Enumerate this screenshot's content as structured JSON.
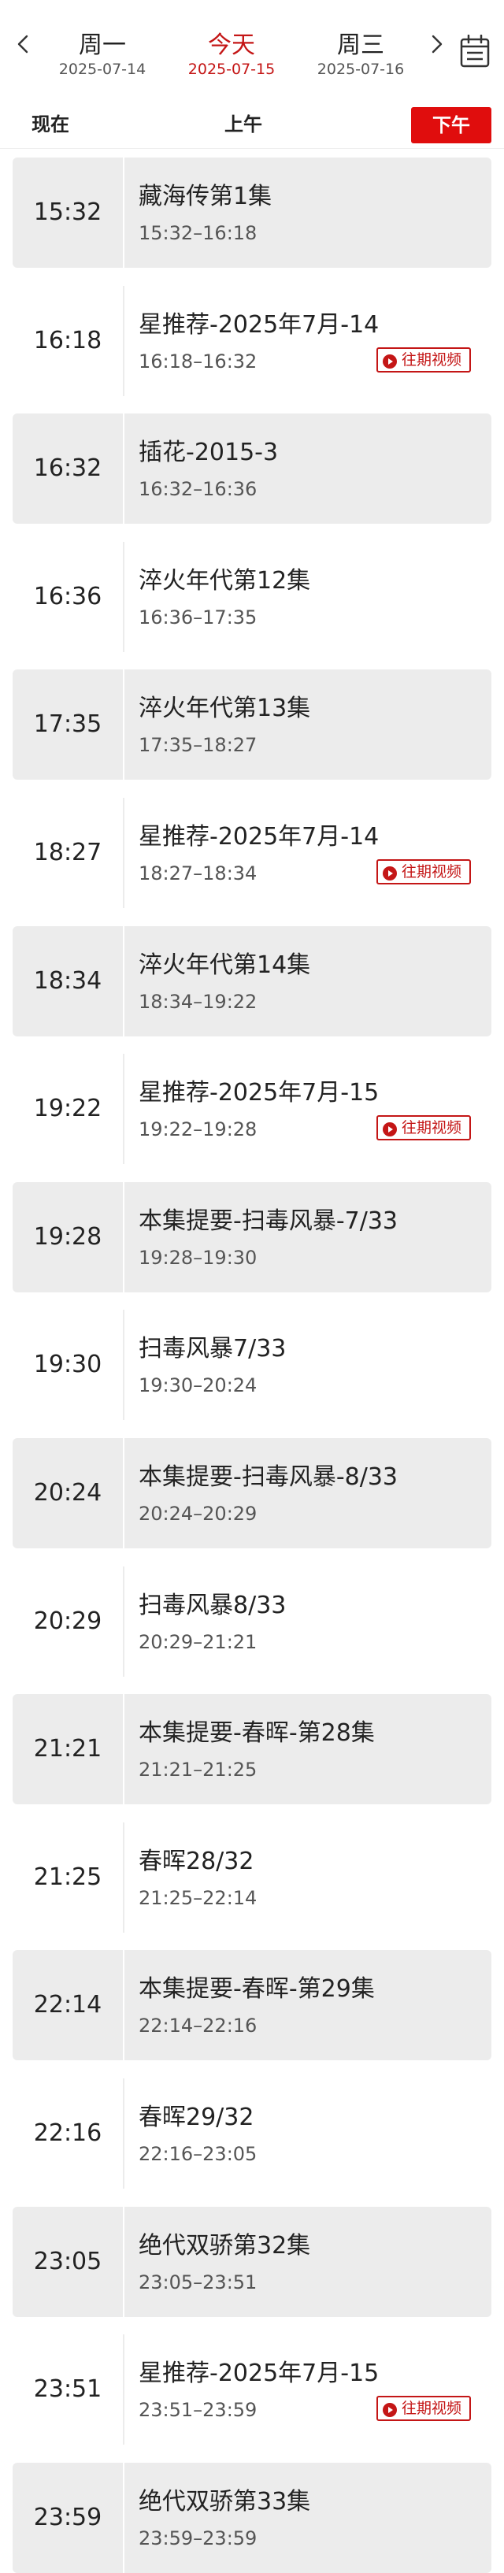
{
  "header": {
    "days": [
      {
        "weekday": "周一",
        "date": "2025-07-14"
      },
      {
        "weekday": "今天",
        "date": "2025-07-15"
      },
      {
        "weekday": "周三",
        "date": "2025-07-16"
      }
    ],
    "active_day": 1
  },
  "periods": {
    "now": "现在",
    "morning": "上午",
    "afternoon": "下午"
  },
  "colors": {
    "accent": "#e00d0d",
    "active_text": "#c41616",
    "card_grey": "#ececec"
  },
  "replay_label": "往期视频",
  "programs": [
    {
      "start": "15:32",
      "title": "藏海传第1集",
      "range": "15:32–16:18",
      "replay": false
    },
    {
      "start": "16:18",
      "title": "星推荐-2025年7月-14",
      "range": "16:18–16:32",
      "replay": true
    },
    {
      "start": "16:32",
      "title": "插花-2015-3",
      "range": "16:32–16:36",
      "replay": false
    },
    {
      "start": "16:36",
      "title": "淬火年代第12集",
      "range": "16:36–17:35",
      "replay": false
    },
    {
      "start": "17:35",
      "title": "淬火年代第13集",
      "range": "17:35–18:27",
      "replay": false
    },
    {
      "start": "18:27",
      "title": "星推荐-2025年7月-14",
      "range": "18:27–18:34",
      "replay": true
    },
    {
      "start": "18:34",
      "title": "淬火年代第14集",
      "range": "18:34–19:22",
      "replay": false
    },
    {
      "start": "19:22",
      "title": "星推荐-2025年7月-15",
      "range": "19:22–19:28",
      "replay": true
    },
    {
      "start": "19:28",
      "title": "本集提要-扫毒风暴-7/33",
      "range": "19:28–19:30",
      "replay": false
    },
    {
      "start": "19:30",
      "title": "扫毒风暴7/33",
      "range": "19:30–20:24",
      "replay": false
    },
    {
      "start": "20:24",
      "title": "本集提要-扫毒风暴-8/33",
      "range": "20:24–20:29",
      "replay": false
    },
    {
      "start": "20:29",
      "title": "扫毒风暴8/33",
      "range": "20:29–21:21",
      "replay": false
    },
    {
      "start": "21:21",
      "title": "本集提要-春晖-第28集",
      "range": "21:21–21:25",
      "replay": false
    },
    {
      "start": "21:25",
      "title": "春晖28/32",
      "range": "21:25–22:14",
      "replay": false
    },
    {
      "start": "22:14",
      "title": "本集提要-春晖-第29集",
      "range": "22:14–22:16",
      "replay": false
    },
    {
      "start": "22:16",
      "title": "春晖29/32",
      "range": "22:16–23:05",
      "replay": false
    },
    {
      "start": "23:05",
      "title": "绝代双骄第32集",
      "range": "23:05–23:51",
      "replay": false
    },
    {
      "start": "23:51",
      "title": "星推荐-2025年7月-15",
      "range": "23:51–23:59",
      "replay": true
    },
    {
      "start": "23:59",
      "title": "绝代双骄第33集",
      "range": "23:59–23:59",
      "replay": false
    }
  ]
}
